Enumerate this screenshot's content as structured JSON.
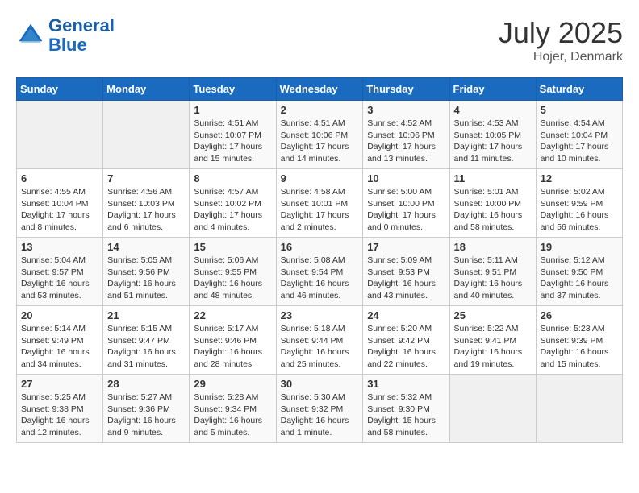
{
  "header": {
    "logo_line1": "General",
    "logo_line2": "Blue",
    "month": "July 2025",
    "location": "Hojer, Denmark"
  },
  "weekdays": [
    "Sunday",
    "Monday",
    "Tuesday",
    "Wednesday",
    "Thursday",
    "Friday",
    "Saturday"
  ],
  "weeks": [
    [
      {
        "day": "",
        "info": ""
      },
      {
        "day": "",
        "info": ""
      },
      {
        "day": "1",
        "info": "Sunrise: 4:51 AM\nSunset: 10:07 PM\nDaylight: 17 hours and 15 minutes."
      },
      {
        "day": "2",
        "info": "Sunrise: 4:51 AM\nSunset: 10:06 PM\nDaylight: 17 hours and 14 minutes."
      },
      {
        "day": "3",
        "info": "Sunrise: 4:52 AM\nSunset: 10:06 PM\nDaylight: 17 hours and 13 minutes."
      },
      {
        "day": "4",
        "info": "Sunrise: 4:53 AM\nSunset: 10:05 PM\nDaylight: 17 hours and 11 minutes."
      },
      {
        "day": "5",
        "info": "Sunrise: 4:54 AM\nSunset: 10:04 PM\nDaylight: 17 hours and 10 minutes."
      }
    ],
    [
      {
        "day": "6",
        "info": "Sunrise: 4:55 AM\nSunset: 10:04 PM\nDaylight: 17 hours and 8 minutes."
      },
      {
        "day": "7",
        "info": "Sunrise: 4:56 AM\nSunset: 10:03 PM\nDaylight: 17 hours and 6 minutes."
      },
      {
        "day": "8",
        "info": "Sunrise: 4:57 AM\nSunset: 10:02 PM\nDaylight: 17 hours and 4 minutes."
      },
      {
        "day": "9",
        "info": "Sunrise: 4:58 AM\nSunset: 10:01 PM\nDaylight: 17 hours and 2 minutes."
      },
      {
        "day": "10",
        "info": "Sunrise: 5:00 AM\nSunset: 10:00 PM\nDaylight: 17 hours and 0 minutes."
      },
      {
        "day": "11",
        "info": "Sunrise: 5:01 AM\nSunset: 10:00 PM\nDaylight: 16 hours and 58 minutes."
      },
      {
        "day": "12",
        "info": "Sunrise: 5:02 AM\nSunset: 9:59 PM\nDaylight: 16 hours and 56 minutes."
      }
    ],
    [
      {
        "day": "13",
        "info": "Sunrise: 5:04 AM\nSunset: 9:57 PM\nDaylight: 16 hours and 53 minutes."
      },
      {
        "day": "14",
        "info": "Sunrise: 5:05 AM\nSunset: 9:56 PM\nDaylight: 16 hours and 51 minutes."
      },
      {
        "day": "15",
        "info": "Sunrise: 5:06 AM\nSunset: 9:55 PM\nDaylight: 16 hours and 48 minutes."
      },
      {
        "day": "16",
        "info": "Sunrise: 5:08 AM\nSunset: 9:54 PM\nDaylight: 16 hours and 46 minutes."
      },
      {
        "day": "17",
        "info": "Sunrise: 5:09 AM\nSunset: 9:53 PM\nDaylight: 16 hours and 43 minutes."
      },
      {
        "day": "18",
        "info": "Sunrise: 5:11 AM\nSunset: 9:51 PM\nDaylight: 16 hours and 40 minutes."
      },
      {
        "day": "19",
        "info": "Sunrise: 5:12 AM\nSunset: 9:50 PM\nDaylight: 16 hours and 37 minutes."
      }
    ],
    [
      {
        "day": "20",
        "info": "Sunrise: 5:14 AM\nSunset: 9:49 PM\nDaylight: 16 hours and 34 minutes."
      },
      {
        "day": "21",
        "info": "Sunrise: 5:15 AM\nSunset: 9:47 PM\nDaylight: 16 hours and 31 minutes."
      },
      {
        "day": "22",
        "info": "Sunrise: 5:17 AM\nSunset: 9:46 PM\nDaylight: 16 hours and 28 minutes."
      },
      {
        "day": "23",
        "info": "Sunrise: 5:18 AM\nSunset: 9:44 PM\nDaylight: 16 hours and 25 minutes."
      },
      {
        "day": "24",
        "info": "Sunrise: 5:20 AM\nSunset: 9:42 PM\nDaylight: 16 hours and 22 minutes."
      },
      {
        "day": "25",
        "info": "Sunrise: 5:22 AM\nSunset: 9:41 PM\nDaylight: 16 hours and 19 minutes."
      },
      {
        "day": "26",
        "info": "Sunrise: 5:23 AM\nSunset: 9:39 PM\nDaylight: 16 hours and 15 minutes."
      }
    ],
    [
      {
        "day": "27",
        "info": "Sunrise: 5:25 AM\nSunset: 9:38 PM\nDaylight: 16 hours and 12 minutes."
      },
      {
        "day": "28",
        "info": "Sunrise: 5:27 AM\nSunset: 9:36 PM\nDaylight: 16 hours and 9 minutes."
      },
      {
        "day": "29",
        "info": "Sunrise: 5:28 AM\nSunset: 9:34 PM\nDaylight: 16 hours and 5 minutes."
      },
      {
        "day": "30",
        "info": "Sunrise: 5:30 AM\nSunset: 9:32 PM\nDaylight: 16 hours and 1 minute."
      },
      {
        "day": "31",
        "info": "Sunrise: 5:32 AM\nSunset: 9:30 PM\nDaylight: 15 hours and 58 minutes."
      },
      {
        "day": "",
        "info": ""
      },
      {
        "day": "",
        "info": ""
      }
    ]
  ]
}
